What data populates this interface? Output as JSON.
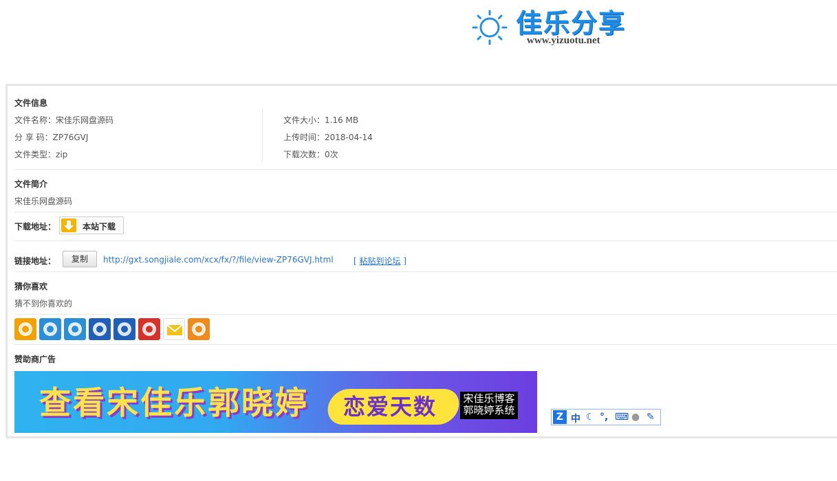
{
  "logo": {
    "brand": "佳乐分享",
    "url": "www.yizuotu.net"
  },
  "file_info": {
    "heading": "文件信息",
    "name_label": "文件名称：",
    "name_value": "宋佳乐网盘源码",
    "share_label": "分 享 码：",
    "share_value": "ZP76GVJ",
    "type_label": "文件类型：",
    "type_value": "zip",
    "size_label": "文件大小：",
    "size_value": "1.16 MB",
    "upload_label": "上传时间：",
    "upload_value": "2018-04-14",
    "downloads_label": "下载次数：",
    "downloads_value": "0次"
  },
  "intro": {
    "heading": "文件简介",
    "text": "宋佳乐网盘源码"
  },
  "download": {
    "label": "下载地址：",
    "button": "本站下载"
  },
  "link": {
    "label": "链接地址：",
    "copy_button": "复制",
    "url": "http://gxt.songjiale.com/xcx/fx/?/file/view-ZP76GVJ.html",
    "paste_open": "[ ",
    "paste_text": "粘贴到论坛",
    "paste_close": " ]"
  },
  "guess": {
    "heading": "猜你喜欢",
    "text": "猜不到你喜欢的"
  },
  "share_icons": [
    "weibo-icon",
    "pengyou-icon",
    "qzone-icon",
    "renren-icon",
    "tencent-weibo-icon",
    "netease-icon",
    "mail-icon",
    "qq-icon"
  ],
  "share_colors": [
    "#f2a100",
    "#2c8fd6",
    "#2c8fd6",
    "#1f5fb8",
    "#1f5fb8",
    "#d6322b",
    "#f5c21b",
    "#f08a1c"
  ],
  "sponsor": {
    "heading": "赞助商广告",
    "ad_big": "查看宋佳乐郭晓婷",
    "ad_pill": "恋爱天数",
    "ad_box_line1": "宋佳乐博客",
    "ad_box_line2": "郭晓婷系统"
  },
  "ime": {
    "zh": "中"
  }
}
